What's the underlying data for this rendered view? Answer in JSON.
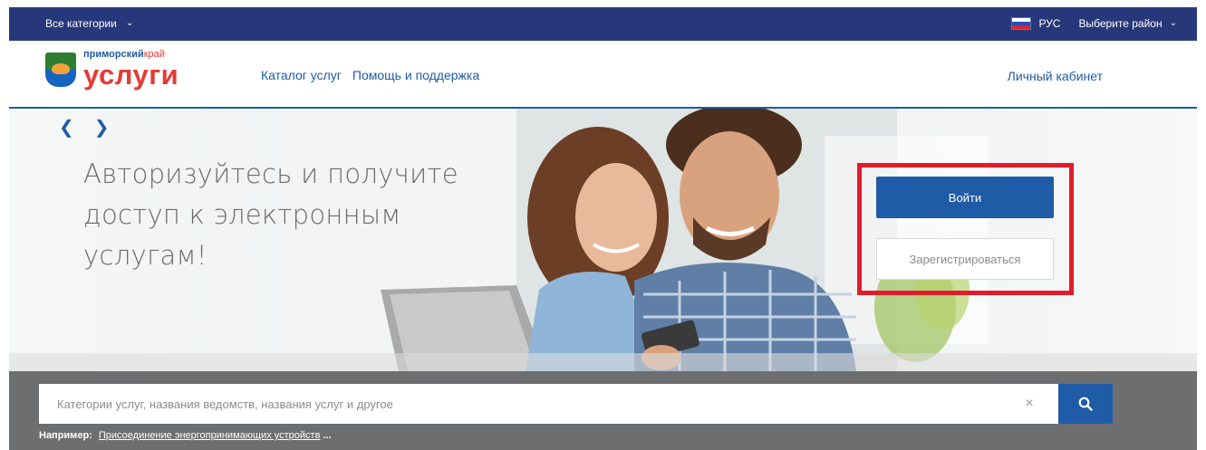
{
  "topbar": {
    "categories_label": "Все категории",
    "language": "РУС",
    "district_label": "Выберите район"
  },
  "header": {
    "logo_sub_primary": "приморский",
    "logo_sub_secondary": "край",
    "logo_main": "услуги",
    "nav": [
      "Каталог услуг",
      "Помощь и поддержка"
    ],
    "cabinet": "Личный кабинет"
  },
  "hero": {
    "title": "Авторизуйтесь и получите доступ к электронным услугам!",
    "login_button": "Войти",
    "register_button": "Зарегистрироваться"
  },
  "search": {
    "placeholder": "Категории услуг, названия ведомств, названия услуг и другое",
    "clear_symbol": "×",
    "example_label": "Например:",
    "example_link": "Присоединение энергопринимающих устройств",
    "example_more": "..."
  },
  "colors": {
    "topbar": "#27387a",
    "brand_blue": "#1f5ba6",
    "brand_red": "#e53935",
    "highlight": "#e21c2c",
    "search_band": "#6d6e70"
  },
  "icons": {
    "prev": "chevron-left-icon",
    "next": "chevron-right-icon",
    "search": "search-icon",
    "flag": "russia-flag-icon"
  }
}
